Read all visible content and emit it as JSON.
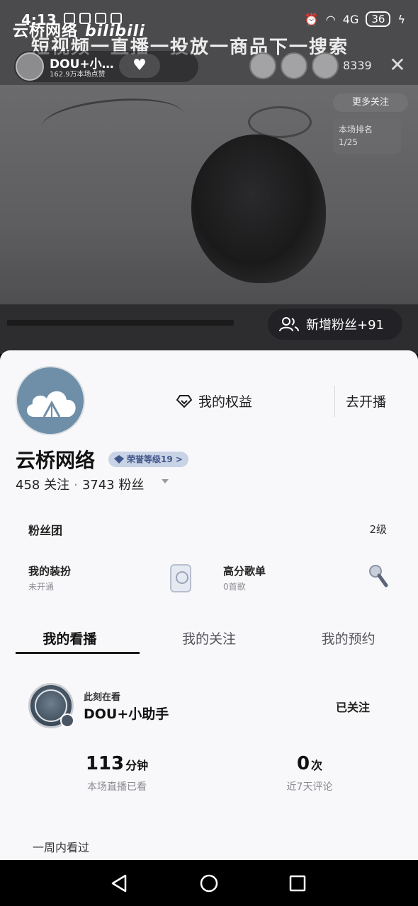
{
  "status_bar": {
    "time": "4:13",
    "network": "4G",
    "battery": "36"
  },
  "stream": {
    "watermark_name": "云桥网络",
    "watermark_brand": "bilibili",
    "title": "短视频一直播一投放一商品下一搜索",
    "anchor_name": "DOU+小…",
    "anchor_likes": "162.9万本场点赞",
    "viewer_count": "8339",
    "more_follow": "更多关注",
    "rank_label": "本场排名",
    "rank_value": "1/25",
    "new_fans": "新增粉丝+91"
  },
  "profile": {
    "rights_label": "我的权益",
    "go_live_label": "去开播",
    "nickname": "云桥网络",
    "honor_level": "荣誉等级19 >",
    "following": "458 关注",
    "followers": "3743 粉丝",
    "fan_club_label": "粉丝团",
    "fan_club_level": "2级",
    "costume_title": "我的装扮",
    "costume_sub": "未开通",
    "songlist_title": "高分歌单",
    "songlist_sub": "0首歌"
  },
  "tabs": [
    {
      "label": "我的看播",
      "active": true
    },
    {
      "label": "我的关注",
      "active": false
    },
    {
      "label": "我的预约",
      "active": false
    }
  ],
  "watching": {
    "label": "此刻在看",
    "name": "DOU+小助手",
    "follow_state": "已关注",
    "watch_minutes": "113",
    "watch_unit": "分钟",
    "watch_caption": "本场直播已看",
    "comments": "0",
    "comments_unit": "次",
    "comments_caption": "近7天评论",
    "week_label": "一周内看过"
  },
  "colors": {
    "sheet_bg": "#f8f8fa",
    "honor_badge_bg": "#c9d3e6",
    "honor_badge_text": "#41568a",
    "nav_bg": "#000000"
  },
  "icons": [
    "back-icon",
    "home-icon",
    "recents-icon",
    "diamond-icon",
    "fans-icon",
    "close-icon",
    "heart-icon"
  ]
}
